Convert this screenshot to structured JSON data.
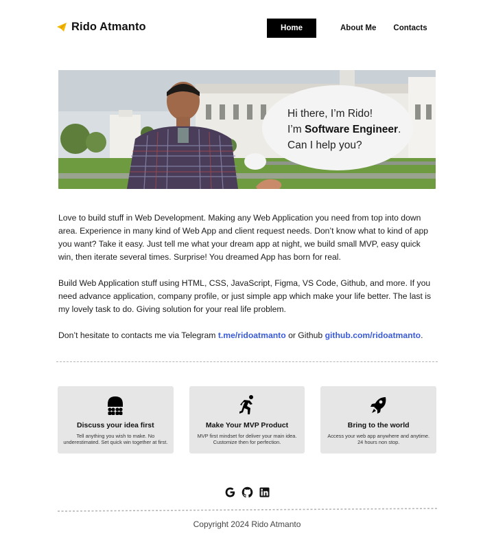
{
  "header": {
    "brand_name": "Rido Atmanto",
    "nav": {
      "home": "Home",
      "about": "About Me",
      "contacts": "Contacts"
    }
  },
  "hero": {
    "line1": "Hi there, I’m Rido!",
    "line2_prefix": "I’m ",
    "line2_bold": "Software Engineer",
    "line2_suffix": ".",
    "line3": "Can I help you?"
  },
  "intro": {
    "p1": "Love to build stuff in Web Development. Making any Web Application you need from top into down area. Experience in many kind of Web App and client request needs. Don’t know what to kind of app you want? Take it easy. Just tell me what your dream app at night, we build small MVP, easy quick win, then iterate several times. Surprise! You dreamed App has born for real.",
    "p2": "Build Web Application stuff using HTML, CSS, JavaScript, Figma, VS Code, Github,  and more. If you need advance application, company profile, or just simple app which make your life better. The last is my lovely task to do. Giving solution for your real life problem.",
    "p3_prefix": "Don’t hesitate to contacts me via Telegram ",
    "telegram_link": "t.me/ridoatmanto",
    "p3_middle": " or Github ",
    "github_link": "github.com/ridoatmanto",
    "p3_suffix": "."
  },
  "cards": [
    {
      "icon": "people-group-icon",
      "title": "Discuss your idea first",
      "desc": "Tell anything you wish to make. No underestimated. Set quick win together at first."
    },
    {
      "icon": "running-person-icon",
      "title": "Make Your MVP Product",
      "desc": "MVP first mindset for deliver your main idea. Customize then for perfection."
    },
    {
      "icon": "rocket-icon",
      "title": "Bring to the world",
      "desc": "Access your web app anywhere and anytime. 24 hours non stop."
    }
  ],
  "footer": {
    "social_icons": [
      "google-icon",
      "github-icon",
      "linkedin-icon"
    ],
    "copyright": "Copyright 2024  Rido Atmanto"
  },
  "colors": {
    "accent": "#f5b800",
    "link": "#3a5bd9",
    "card_bg": "#e6e6e6",
    "nav_active_bg": "#000000"
  }
}
